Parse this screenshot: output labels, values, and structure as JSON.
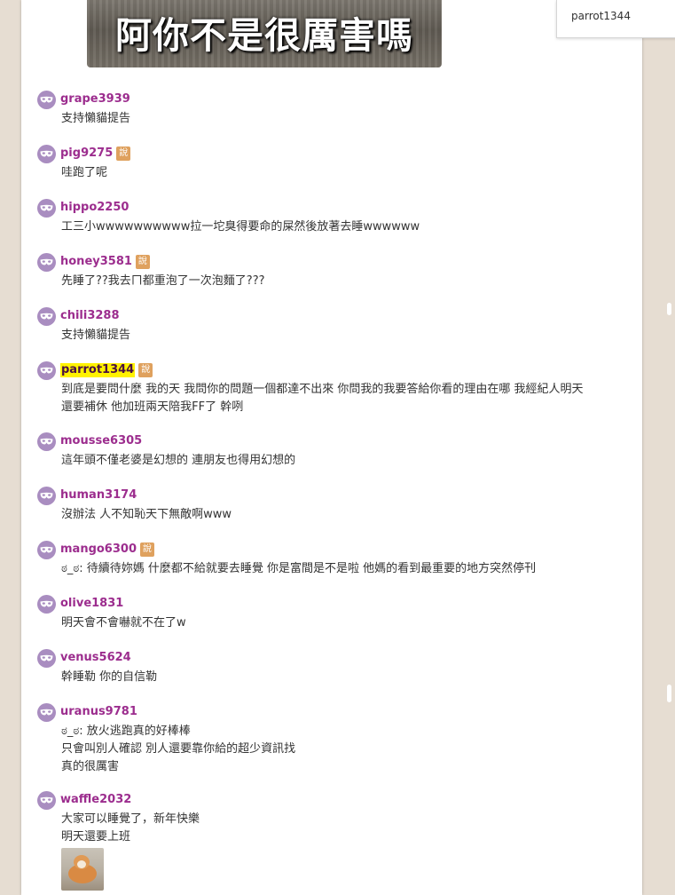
{
  "banner": {
    "text": "阿你不是很厲害嗎"
  },
  "current_user": "parrot1344",
  "badge_label": "說",
  "comments": [
    {
      "user": "grape3939",
      "badge": false,
      "highlight": false,
      "lines": [
        "支持懶貓提告"
      ]
    },
    {
      "user": "pig9275",
      "badge": true,
      "highlight": false,
      "lines": [
        "哇跑了呢"
      ]
    },
    {
      "user": "hippo2250",
      "badge": false,
      "highlight": false,
      "lines": [
        "工三小wwwwwwwwww拉一坨臭得要命的屎然後放著去睡wwwwww"
      ]
    },
    {
      "user": "honey3581",
      "badge": true,
      "highlight": false,
      "lines": [
        "先睡了??我去ㄇ都重泡了一次泡麵了???"
      ]
    },
    {
      "user": "chili3288",
      "badge": false,
      "highlight": false,
      "lines": [
        "支持懶貓提告"
      ]
    },
    {
      "user": "parrot1344",
      "badge": true,
      "highlight": true,
      "lines": [
        "到底是要問什麼 我的天 我問你的問題一個都達不出來 你問我的我要答給你看的理由在哪 我經紀人明天",
        "還要補休 他加班兩天陪我FF了 幹咧"
      ]
    },
    {
      "user": "mousse6305",
      "badge": false,
      "highlight": false,
      "lines": [
        "這年頭不僅老婆是幻想的 連朋友也得用幻想的"
      ]
    },
    {
      "user": "human3174",
      "badge": false,
      "highlight": false,
      "lines": [
        "沒辦法 人不知恥天下無敵啊www"
      ]
    },
    {
      "user": "mango6300",
      "badge": true,
      "highlight": false,
      "lines": [
        "ಠ_ಠ: 待續待妳媽 什麼都不給就要去睡覺 你是富間是不是啦 他媽的看到最重要的地方突然停刊"
      ]
    },
    {
      "user": "olive1831",
      "badge": false,
      "highlight": false,
      "lines": [
        "明天會不會嚇就不在了w"
      ]
    },
    {
      "user": "venus5624",
      "badge": false,
      "highlight": false,
      "lines": [
        "幹睡勒 你的自信勒"
      ]
    },
    {
      "user": "uranus9781",
      "badge": false,
      "highlight": false,
      "lines": [
        "ಠ_ಠ: 放火逃跑真的好棒棒",
        "只會叫別人確認 別人還要靠你給的超少資訊找",
        "真的很厲害"
      ]
    },
    {
      "user": "waffle2032",
      "badge": false,
      "highlight": false,
      "lines": [
        "大家可以睡覺了，新年快樂",
        "明天還要上班"
      ],
      "image": "shiba-dog-photo"
    }
  ]
}
